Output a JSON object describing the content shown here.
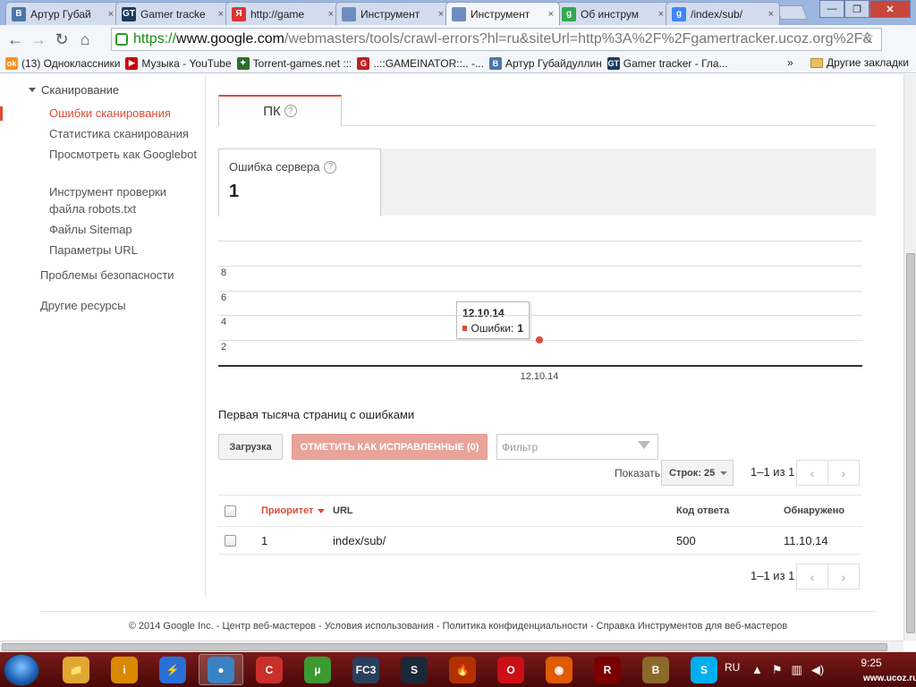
{
  "browser": {
    "tabs": [
      {
        "label": "Артур Губай",
        "icon_text": "В",
        "icon_color": "#4a76a8"
      },
      {
        "label": "Gamer tracke",
        "icon_text": "GT",
        "icon_color": "#1e3a5f"
      },
      {
        "label": "http://game",
        "icon_text": "Я",
        "icon_color": "#d33"
      },
      {
        "label": "Инструмент",
        "icon_text": "",
        "icon_color": "#6c8ebf"
      },
      {
        "label": "Инструмент",
        "icon_text": "",
        "icon_color": "#6c8ebf"
      },
      {
        "label": "Об инструм",
        "icon_text": "g",
        "icon_color": "#34a853"
      },
      {
        "label": "/index/sub/",
        "icon_text": "g",
        "icon_color": "#4285f4"
      }
    ],
    "active_tab_index": 4,
    "tab_close": "×",
    "url_scheme": "https://",
    "url_host": "www.google.com",
    "url_path": "/webmasters/tools/crawl-errors?hl=ru&siteUrl=http%3A%2F%2Fgamertracker.ucoz.org%2F&",
    "bookmarks": [
      {
        "label": "(13) Одноклассники",
        "icon_text": "ok",
        "icon_color": "#f7931e"
      },
      {
        "label": "Музыка - YouTube",
        "icon_text": "▶",
        "icon_color": "#cc0000"
      },
      {
        "label": "Torrent-games.net :::",
        "icon_text": "✦",
        "icon_color": "#2b6e2b"
      },
      {
        "label": "..::GAMEINATOR::.. -...",
        "icon_text": "G",
        "icon_color": "#b22"
      },
      {
        "label": "Артур Губайдуллин",
        "icon_text": "В",
        "icon_color": "#4a76a8"
      },
      {
        "label": "Gamer tracker - Гла...",
        "icon_text": "GT",
        "icon_color": "#1e3a5f"
      }
    ],
    "bookmarks_more": "»",
    "other_bookmarks": "Другие закладки"
  },
  "sidebar": {
    "section": "Сканирование",
    "items": [
      {
        "label": "Ошибки сканирования",
        "active": true
      },
      {
        "label": "Статистика сканирования",
        "active": false
      },
      {
        "label": "Просмотреть как Googlebot",
        "active": false
      },
      {
        "label": "Инструмент проверки файла robots.txt",
        "active": false
      },
      {
        "label": "Файлы Sitemap",
        "active": false
      },
      {
        "label": "Параметры URL",
        "active": false
      }
    ],
    "security": "Проблемы безопасности",
    "other": "Другие ресурсы"
  },
  "main": {
    "device_tab": "ПК",
    "help_glyph": "?",
    "error_label": "Ошибка сервера",
    "error_count": "1",
    "tooltip": {
      "date": "12.10.14",
      "label": "Ошибки:",
      "value": "1"
    },
    "section_title": "Первая тысяча страниц с ошибками",
    "download": "Загрузка",
    "mark_fixed": "ОТМЕТИТЬ КАК ИСПРАВЛЕННЫЕ (0)",
    "filter_placeholder": "Фильтр",
    "show_label": "Показать",
    "rows_label": "Строк: 25",
    "page_count": "1–1 из 1",
    "prev": "‹",
    "next": "›",
    "table": {
      "headers": {
        "priority": "Приоритет",
        "url": "URL",
        "code": "Код ответа",
        "detected": "Обнаружено"
      },
      "rows": [
        {
          "priority": "1",
          "url": "index/sub/",
          "code": "500",
          "detected": "11.10.14"
        }
      ]
    }
  },
  "chart_data": {
    "type": "scatter",
    "x": [
      "12.10.14"
    ],
    "series": [
      {
        "name": "Ошибки",
        "values": [
          1
        ]
      }
    ],
    "yticks": [
      2,
      4,
      6,
      8
    ],
    "ylim": [
      0,
      10
    ],
    "xtick_labels": [
      "12.10.14"
    ],
    "grid": true,
    "color": "#dd4b39"
  },
  "footer": {
    "text": "© 2014 Google Inc. - Центр веб-мастеров - Условия использования - Политика конфиденциальности - Справка Инструментов для веб-мастеров"
  },
  "taskbar": {
    "apps": [
      {
        "name": "explorer",
        "color": "#e0a830",
        "glyph": "📁"
      },
      {
        "name": "info",
        "color": "#d98a00",
        "glyph": "i"
      },
      {
        "name": "thunder",
        "color": "#2a6fd6",
        "glyph": "⚡"
      },
      {
        "name": "chrome",
        "color": "#3b82c4",
        "glyph": "●"
      },
      {
        "name": "ccleaner",
        "color": "#c9302c",
        "glyph": "C"
      },
      {
        "name": "utorrent",
        "color": "#3c9a30",
        "glyph": "µ"
      },
      {
        "name": "fc3",
        "color": "#2a3f5c",
        "glyph": "FC3"
      },
      {
        "name": "steam",
        "color": "#1b2838",
        "glyph": "S"
      },
      {
        "name": "fire",
        "color": "#b33000",
        "glyph": "🔥"
      },
      {
        "name": "opera",
        "color": "#cc0f16",
        "glyph": "O"
      },
      {
        "name": "origin",
        "color": "#e05a00",
        "glyph": "◉"
      },
      {
        "name": "game",
        "color": "#7a0000",
        "glyph": "R"
      },
      {
        "name": "bioshock",
        "color": "#8a6a2a",
        "glyph": "B"
      },
      {
        "name": "skype",
        "color": "#00aff0",
        "glyph": "S"
      }
    ],
    "active_app_index": 3,
    "lang": "RU",
    "time": "9:25",
    "watermark": "www.ucoz.ru"
  }
}
